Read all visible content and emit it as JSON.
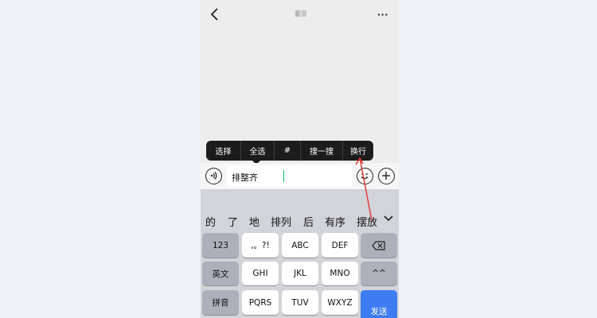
{
  "header": {
    "back_icon": "chevron-left-icon",
    "more_label": "···"
  },
  "context_menu": {
    "items": [
      "选择",
      "全选",
      "#",
      "搜一搜",
      "换行"
    ]
  },
  "input": {
    "value": "排整齐",
    "voice_icon": "voice-icon",
    "emoji_icon": "emoji-icon",
    "plus_icon": "plus-icon"
  },
  "keyboard": {
    "candidates": [
      "的",
      "了",
      "地",
      "排列",
      "后",
      "有序",
      "摆放"
    ],
    "expand_icon": "chevron-down-icon",
    "row1": [
      "123",
      ",。?!",
      "ABC",
      "DEF"
    ],
    "row2": [
      "英文",
      "GHI",
      "JKL",
      "MNO",
      "^^"
    ],
    "row3": [
      "拼音",
      "PQRS",
      "TUV",
      "WXYZ",
      "发送"
    ],
    "backspace_icon": "backspace-icon"
  },
  "colors": {
    "menu_bg": "#1c1c1c",
    "caret": "#07c160",
    "send_key": "#3d7cf2",
    "annotation": "#e5322d"
  }
}
